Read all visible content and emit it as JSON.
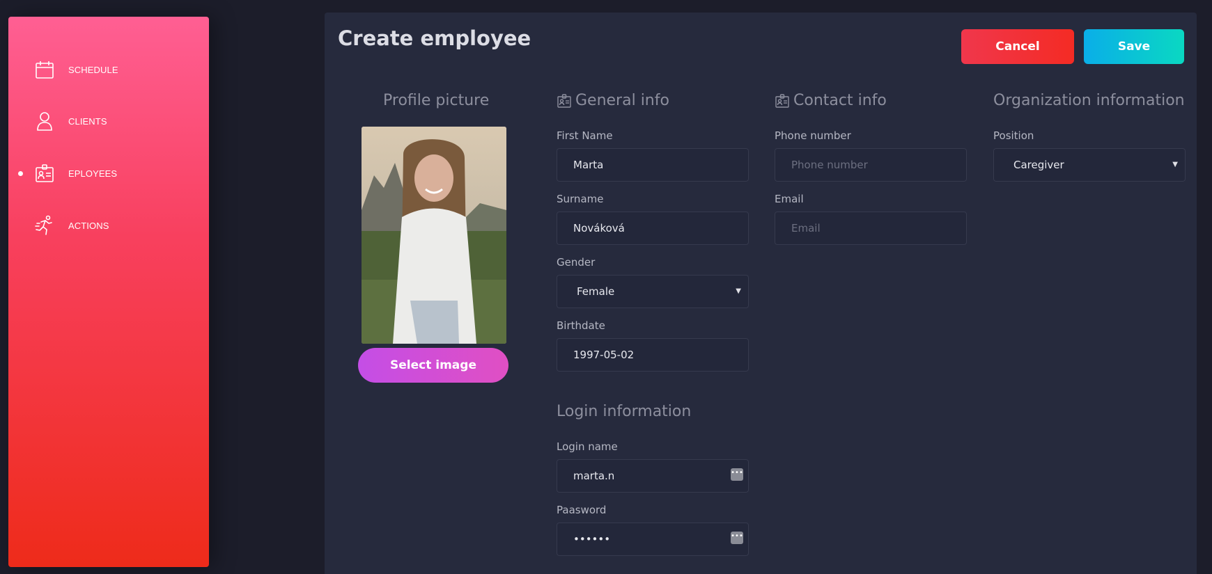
{
  "sidebar": {
    "items": [
      {
        "label": "SCHEDULE",
        "icon": "calendar-icon",
        "active": false
      },
      {
        "label": "CLIENTS",
        "icon": "user-icon",
        "active": false
      },
      {
        "label": "EPLOYEES",
        "icon": "id-card-icon",
        "active": true
      },
      {
        "label": "ACTIONS",
        "icon": "running-person-icon",
        "active": false
      }
    ]
  },
  "header": {
    "title": "Create employee",
    "cancel_label": "Cancel",
    "save_label": "Save"
  },
  "profile": {
    "title": "Profile picture",
    "select_label": "Select image"
  },
  "general": {
    "title": "General info",
    "first_name_label": "First Name",
    "first_name_value": "Marta",
    "surname_label": "Surname",
    "surname_value": "Nováková",
    "gender_label": "Gender",
    "gender_value": "Female",
    "birthdate_label": "Birthdate",
    "birthdate_value": "1997-05-02"
  },
  "contact": {
    "title": "Contact info",
    "phone_label": "Phone number",
    "phone_placeholder": "Phone number",
    "email_label": "Email",
    "email_placeholder": "Email"
  },
  "organization": {
    "title": "Organization information",
    "position_label": "Position",
    "position_value": "Caregiver"
  },
  "login": {
    "title": "Login information",
    "login_name_label": "Login name",
    "login_name_value": "marta.n",
    "password_label": "Paasword",
    "password_value": "••••••"
  },
  "colors": {
    "sidebar_top": "#ff5f93",
    "sidebar_bottom": "#ee2b1a",
    "panel_bg": "#262a3d",
    "cancel": "#f2313a",
    "save": "#0abfd8",
    "select_image": "#d04fd8"
  }
}
